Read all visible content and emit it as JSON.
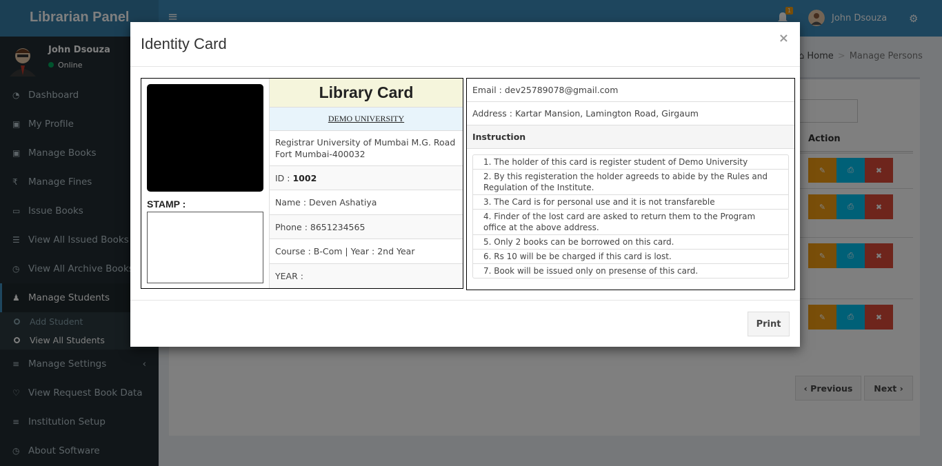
{
  "app": {
    "brand": "Librarian Panel",
    "user_name": "John Dsouza",
    "user_status": "Online",
    "notification_count": "1"
  },
  "sidebar": {
    "items": [
      {
        "label": "Dashboard",
        "icon": "dashboard-icon"
      },
      {
        "label": "My Profile",
        "icon": "gift-icon"
      },
      {
        "label": "Manage Books",
        "icon": "gift-icon"
      },
      {
        "label": "Manage Fines",
        "icon": "rupee-icon"
      },
      {
        "label": "Issue Books",
        "icon": "folder-open-icon"
      },
      {
        "label": "View All Issued Books",
        "icon": "list-icon"
      },
      {
        "label": "View All Archive Books",
        "icon": "clock-icon"
      },
      {
        "label": "Manage Students",
        "icon": "users-icon"
      },
      {
        "label": "Manage Settings",
        "icon": "sliders-icon"
      },
      {
        "label": "View Request Book Data",
        "icon": "heart-icon"
      },
      {
        "label": "Institution Setup",
        "icon": "sliders-icon"
      },
      {
        "label": "About Software",
        "icon": "clock-icon"
      }
    ],
    "sub_items": [
      "Add Student",
      "View All Students"
    ]
  },
  "breadcrumb": {
    "home": "Home",
    "current": "Manage Persons"
  },
  "table": {
    "action_header": "Action"
  },
  "pager": {
    "previous": "Previous",
    "next": "Next"
  },
  "modal": {
    "title": "Identity Card",
    "close": "×",
    "print": "Print",
    "card": {
      "heading": "Library Card",
      "university": "DEMO UNIVERSITY",
      "registrar": "Registrar University of Mumbai M.G. Road Fort Mumbai-400032",
      "id_label": "ID : ",
      "id_value": "1002",
      "name": "Name : Deven Ashatiya",
      "phone": "Phone : 8651234565",
      "course": "Course : B-Com | Year : 2nd Year",
      "year": "YEAR :",
      "stamp": "STAMP :",
      "email": "Email : dev25789078@gmail.com",
      "address": "Address : Kartar Mansion, Lamington Road, Girgaum",
      "instruction_heading": "Instruction",
      "instructions": [
        "1. The holder of this card is register student of Demo University",
        "2. By this registeration the holder agreeds to abide by the Rules and Regulation of the Institute.",
        "3. The Card is for personal use and it is not transfareble",
        "4. Finder of the lost card are asked to return them to the Program office at the above address.",
        "5. Only 2 books can be borrowed on this card.",
        "6. Rs 10 will be be charged if this card is lost.",
        "7. Book will be issued only on presense of this card."
      ]
    }
  }
}
